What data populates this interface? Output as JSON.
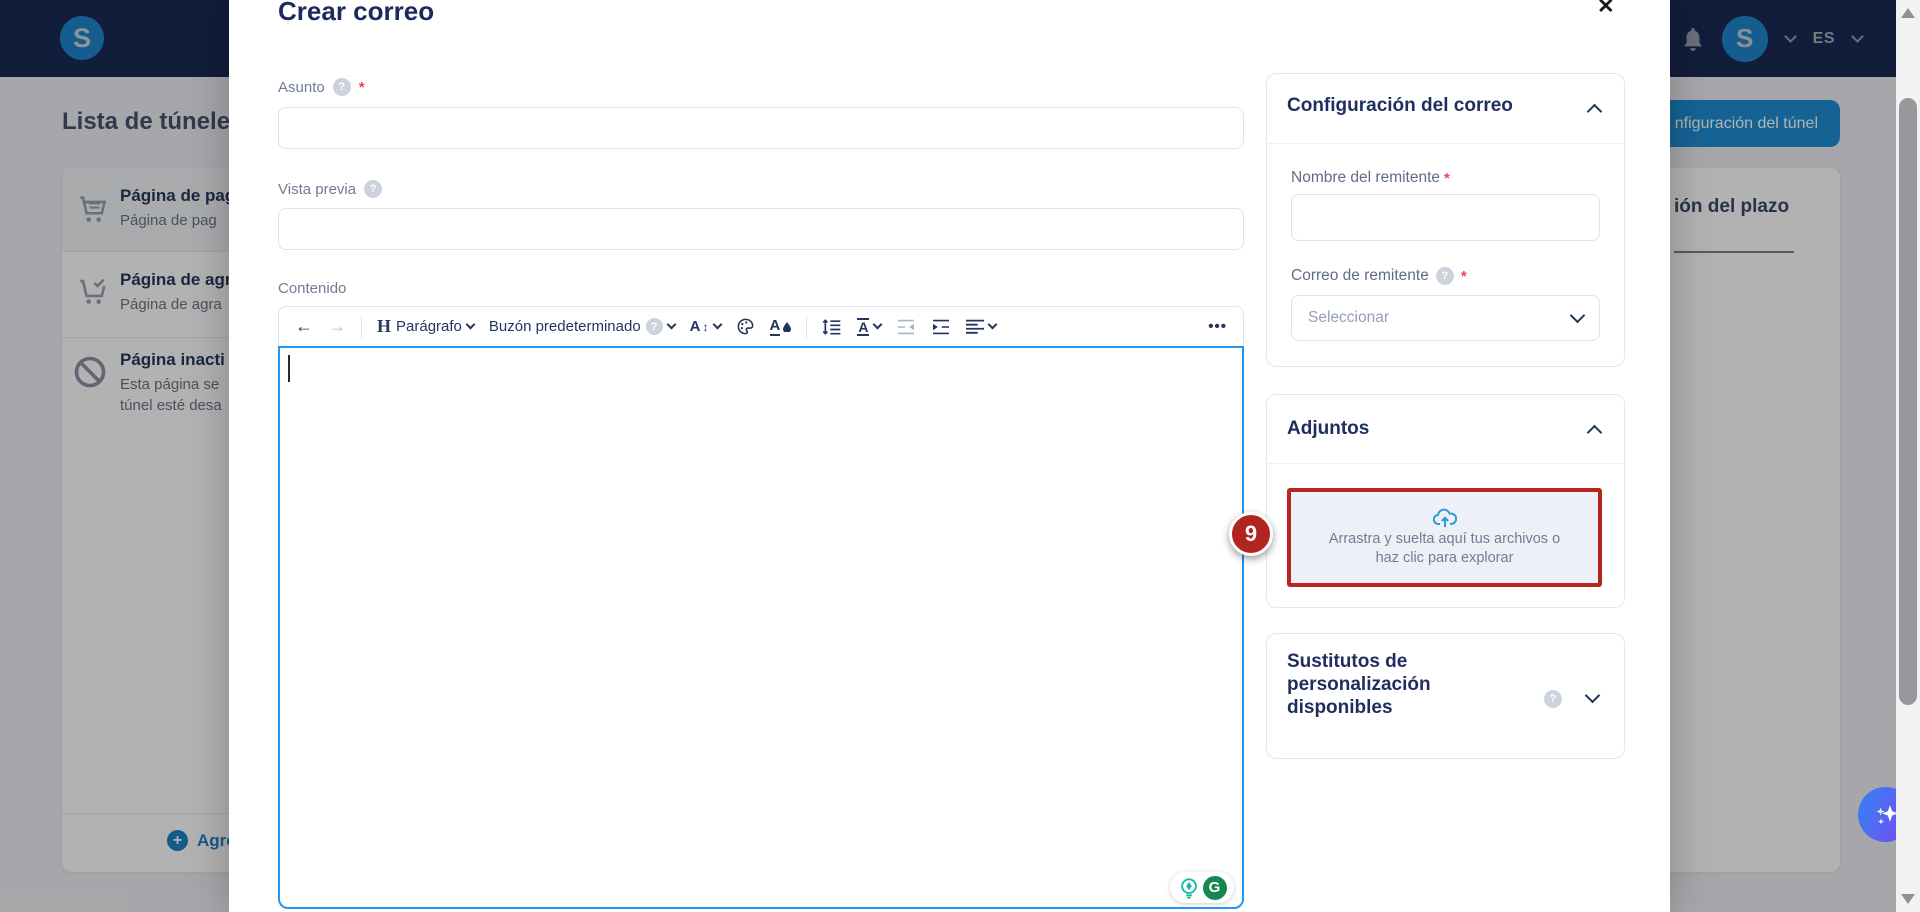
{
  "header": {
    "logo_letter": "S",
    "avatar_letter": "S",
    "language": "ES"
  },
  "background": {
    "page_title": "Lista de túnele",
    "tunnel_list": [
      {
        "icon": "cart-icon",
        "title": "Página de pag",
        "subtitle": "Página de pag"
      },
      {
        "icon": "cart-check-icon",
        "title": "Página de agr",
        "subtitle": "Página de agra"
      },
      {
        "icon": "block-icon",
        "title": "Página inacti",
        "subtitle": "Esta página se",
        "subtitle2": "túnel esté desa"
      }
    ],
    "add_link_label": "Agre",
    "tunnel_config_button": "nfiguración del túnel",
    "deadline_card_title": "ión del plazo"
  },
  "modal": {
    "title": "Crear correo",
    "close_glyph": "✕",
    "fields": {
      "subject_label": "Asunto",
      "preview_label": "Vista previa",
      "content_label": "Contenido"
    },
    "toolbar": {
      "undo_glyph": "←",
      "redo_glyph": "→",
      "heading_glyph": "H",
      "paragraph_label": "Parágrafo",
      "mailbox_label": "Buzón predeterminado",
      "font_size_glyph": "A",
      "updown_glyph": "↕",
      "font_letter": "A",
      "more_glyph": "•••",
      "help_glyph": "?"
    },
    "settings": {
      "title": "Configuración del correo",
      "sender_name_label": "Nombre del remitente",
      "sender_email_label": "Correo de remitente",
      "sender_email_placeholder": "Seleccionar",
      "required_glyph": "*",
      "help_glyph": "?"
    },
    "attachments": {
      "title": "Adjuntos",
      "dropzone_line1": "Arrastra y suelta aquí tus archivos o",
      "dropzone_line2": "haz clic para explorar",
      "annotation_badge": "9"
    },
    "substitutes": {
      "title_line1": "Sustitutos de",
      "title_line2": "personalización",
      "title_line3": "disponibles",
      "help_glyph": "?"
    },
    "grammarly": {
      "g_letter": "G"
    }
  },
  "colors": {
    "header_navy": "#1a2a55",
    "brand_blue": "#1e86cc",
    "primary_button_blue": "#1f8fd6",
    "editor_focus_blue": "#2196f3",
    "annotation_red": "#b5261e",
    "badge_red": "#b02520",
    "title_navy": "#1f2e5e",
    "grammarly_green": "#15884f",
    "suggestion_teal": "#14b8a6",
    "fab_gradient_start": "#3d7bf5",
    "fab_gradient_end": "#7150ee"
  }
}
